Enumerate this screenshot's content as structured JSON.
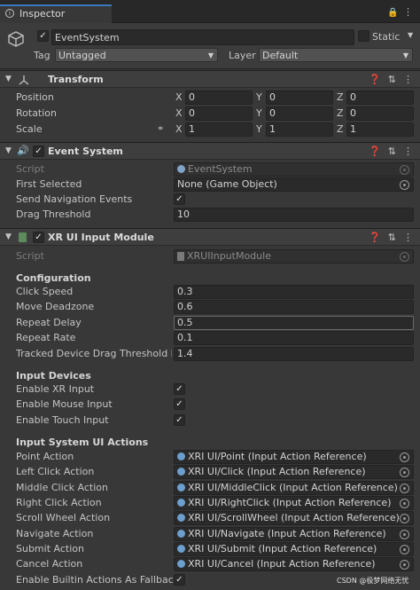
{
  "tab": {
    "title": "Inspector"
  },
  "header": {
    "object_name": "EventSystem",
    "static_label": "Static",
    "tag_label": "Tag",
    "tag_value": "Untagged",
    "layer_label": "Layer",
    "layer_value": "Default"
  },
  "transform": {
    "title": "Transform",
    "axes": [
      "X",
      "Y",
      "Z"
    ],
    "rows": [
      {
        "label": "Position",
        "values": [
          "0",
          "0",
          "0"
        ]
      },
      {
        "label": "Rotation",
        "values": [
          "0",
          "0",
          "0"
        ]
      },
      {
        "label": "Scale",
        "values": [
          "1",
          "1",
          "1"
        ]
      }
    ]
  },
  "event_system": {
    "title": "Event System",
    "script_label": "Script",
    "script_value": "EventSystem",
    "first_selected_label": "First Selected",
    "first_selected_value": "None (Game Object)",
    "send_nav_label": "Send Navigation Events",
    "drag_label": "Drag Threshold",
    "drag_value": "10"
  },
  "xr_module": {
    "title": "XR UI Input Module",
    "script_label": "Script",
    "script_value": "XRUIInputModule",
    "config_title": "Configuration",
    "config": [
      {
        "label": "Click Speed",
        "value": "0.3"
      },
      {
        "label": "Move Deadzone",
        "value": "0.6"
      },
      {
        "label": "Repeat Delay",
        "value": "0.5"
      },
      {
        "label": "Repeat Rate",
        "value": "0.1"
      },
      {
        "label": "Tracked Device Drag Threshold M",
        "value": "1.4"
      }
    ],
    "devices_title": "Input Devices",
    "devices": [
      "Enable XR Input",
      "Enable Mouse Input",
      "Enable Touch Input"
    ],
    "actions_title": "Input System UI Actions",
    "actions": [
      {
        "label": "Point Action",
        "value": "XRI UI/Point (Input Action Reference)"
      },
      {
        "label": "Left Click Action",
        "value": "XRI UI/Click (Input Action Reference)"
      },
      {
        "label": "Middle Click Action",
        "value": "XRI UI/MiddleClick (Input Action Reference)"
      },
      {
        "label": "Right Click Action",
        "value": "XRI UI/RightClick (Input Action Reference)"
      },
      {
        "label": "Scroll Wheel Action",
        "value": "XRI UI/ScrollWheel (Input Action Reference)"
      },
      {
        "label": "Navigate Action",
        "value": "XRI UI/Navigate (Input Action Reference)"
      },
      {
        "label": "Submit Action",
        "value": "XRI UI/Submit (Input Action Reference)"
      },
      {
        "label": "Cancel Action",
        "value": "XRI UI/Cancel (Input Action Reference)"
      }
    ],
    "fallback_label": "Enable Builtin Actions As Fallback"
  },
  "watermark": "CSDN @极梦网络无忧"
}
